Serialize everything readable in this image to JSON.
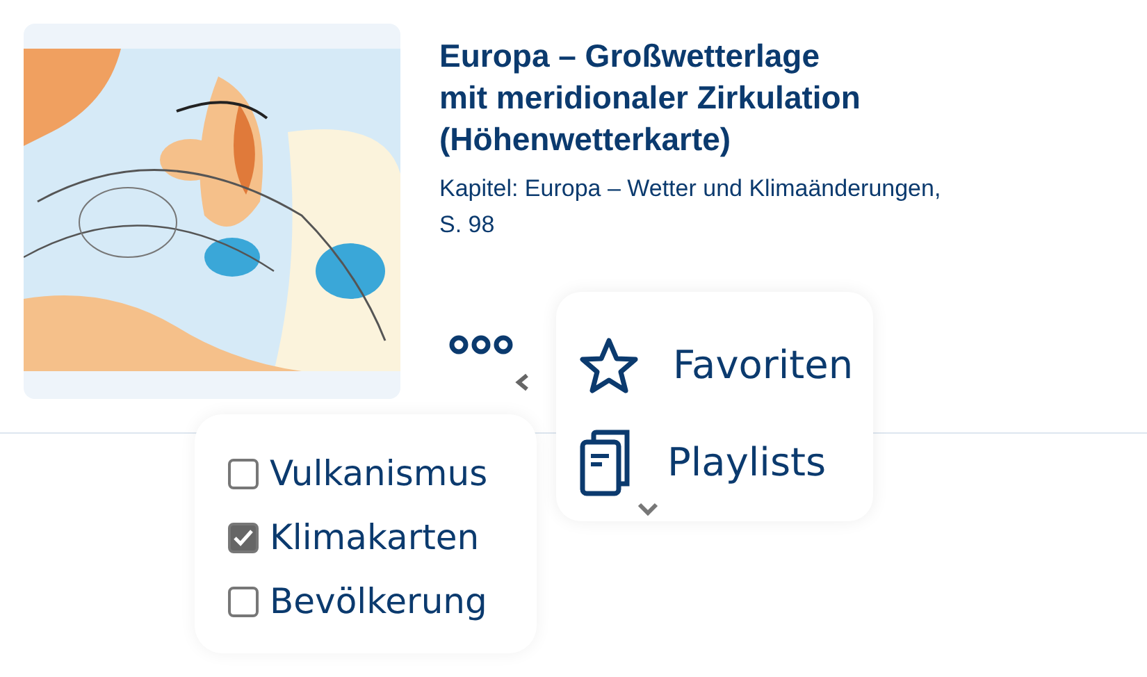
{
  "item": {
    "kind": "picture",
    "title": "Europa – Großwetterlage\nmit meridionaler Zirkulation\n(Höhenwetterkarte)",
    "chapter": "Kapitel: Europa – Wetter und Klimaänderungen,\nS. 98"
  },
  "menu": [
    {
      "label": "Favoriten",
      "kind": "star"
    },
    {
      "label": "Playlists",
      "kind": "playlist"
    }
  ],
  "categories": [
    {
      "label": "Vulkanismus",
      "checked": false
    },
    {
      "label": "Klimakarten",
      "checked": true
    },
    {
      "label": "Bevölkerung",
      "checked": false
    }
  ]
}
